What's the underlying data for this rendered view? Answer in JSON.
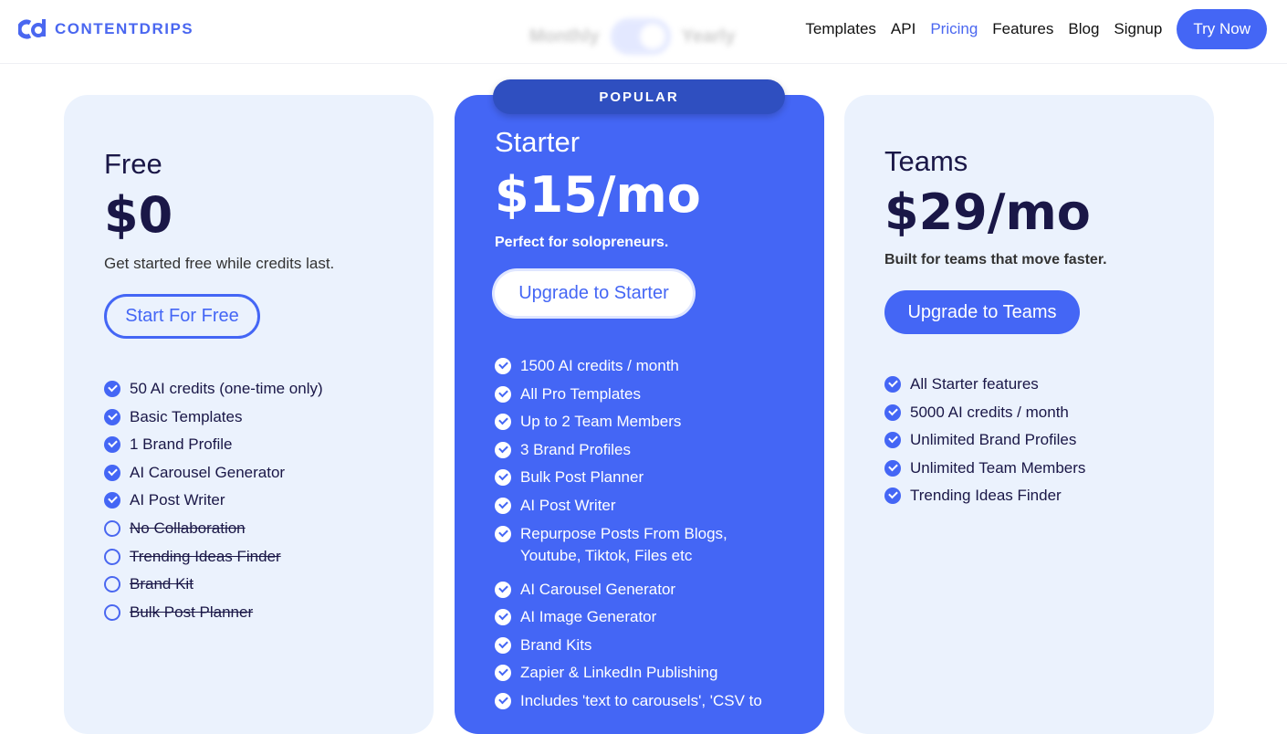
{
  "header": {
    "logo": "CONTENTDRIPS",
    "toggle": {
      "monthly": "Monthly",
      "yearly": "Yearly"
    },
    "nav": [
      "Templates",
      "API",
      "Pricing",
      "Features",
      "Blog",
      "Signup"
    ],
    "cta": "Try Now"
  },
  "plans": [
    {
      "name": "Free",
      "price": "$0",
      "desc": "Get started free while credits last.",
      "button": "Start For Free",
      "features": [
        {
          "t": "50 AI credits (one-time only)",
          "on": true
        },
        {
          "t": "Basic Templates",
          "on": true
        },
        {
          "t": "1 Brand Profile",
          "on": true
        },
        {
          "t": "AI Carousel Generator",
          "on": true
        },
        {
          "t": "AI Post Writer",
          "on": true
        },
        {
          "t": "No Collaboration",
          "on": false
        },
        {
          "t": "Trending Ideas Finder",
          "on": false
        },
        {
          "t": "Brand Kit",
          "on": false
        },
        {
          "t": "Bulk Post Planner",
          "on": false
        }
      ]
    },
    {
      "badge": "POPULAR",
      "name": "Starter",
      "price": "$15/mo",
      "desc": "Perfect for solopreneurs.",
      "button": "Upgrade to Starter",
      "features": [
        "1500 AI credits / month",
        "All Pro Templates",
        "Up to 2 Team Members",
        "3 Brand Profiles",
        "Bulk Post Planner",
        "AI Post Writer",
        "Repurpose Posts From Blogs, Youtube, Tiktok, Files etc",
        "AI Carousel Generator",
        "AI Image Generator",
        "Brand Kits",
        "Zapier & LinkedIn Publishing",
        "Includes 'text to carousels', 'CSV to"
      ]
    },
    {
      "name": "Teams",
      "price": "$29/mo",
      "desc": "Built for teams that move faster.",
      "button": "Upgrade to Teams",
      "features": [
        "All Starter features",
        "5000 AI credits / month",
        "Unlimited Brand Profiles",
        "Unlimited Team Members",
        "Trending Ideas Finder"
      ]
    }
  ]
}
